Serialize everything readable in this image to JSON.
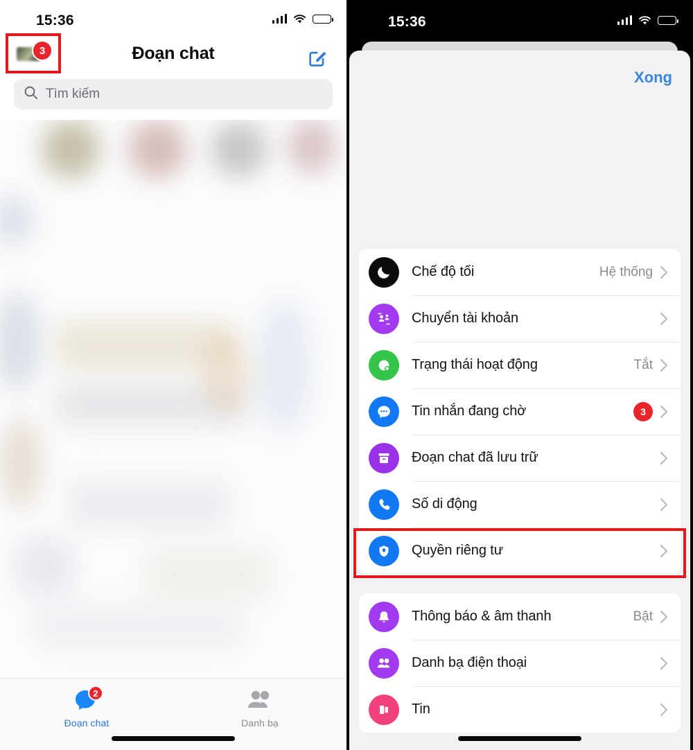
{
  "left": {
    "status_bar": {
      "time": "15:36",
      "signal_icon": "cellular-bars-icon",
      "wifi_icon": "wifi-icon",
      "battery_icon": "battery-icon"
    },
    "header": {
      "title": "Đoạn chat",
      "avatar_badge": "3",
      "compose_icon": "compose-icon",
      "avatar_name": "profile-avatar"
    },
    "search": {
      "placeholder": "Tìm kiếm",
      "icon": "search-icon"
    },
    "tabs": [
      {
        "label": "Đoạn chat",
        "icon": "chat-bubble-icon",
        "badge": "2",
        "active": true
      },
      {
        "label": "Danh bạ",
        "icon": "contacts-icon",
        "badge": "",
        "active": false
      }
    ]
  },
  "right": {
    "status_bar": {
      "time": "15:36",
      "signal_icon": "cellular-bars-icon",
      "wifi_icon": "wifi-icon",
      "battery_icon": "battery-icon"
    },
    "sheet": {
      "done_label": "Xong"
    },
    "groups": [
      {
        "rows": [
          {
            "label": "Chế độ tối",
            "value": "Hệ thống",
            "badge": "",
            "icon": "moon-icon",
            "color": "#0b0b0b"
          },
          {
            "label": "Chuyển tài khoản",
            "value": "",
            "badge": "",
            "icon": "switch-account-icon",
            "color": "#a23bef"
          },
          {
            "label": "Trạng thái hoạt động",
            "value": "Tắt",
            "badge": "",
            "icon": "active-status-icon",
            "color": "#35c44a"
          },
          {
            "label": "Tin nhắn đang chờ",
            "value": "",
            "badge": "3",
            "icon": "message-requests-icon",
            "color": "#1278f3"
          },
          {
            "label": "Đoạn chat đã lưu trữ",
            "value": "",
            "badge": "",
            "icon": "archive-icon",
            "color": "#9a33e8"
          },
          {
            "label": "Số di động",
            "value": "",
            "badge": "",
            "icon": "phone-icon",
            "color": "#1278f3"
          },
          {
            "label": "Quyền riêng tư",
            "value": "",
            "badge": "",
            "icon": "shield-icon",
            "color": "#1278f3",
            "highlighted": true
          }
        ]
      },
      {
        "rows": [
          {
            "label": "Thông báo & âm thanh",
            "value": "Bật",
            "badge": "",
            "icon": "bell-icon",
            "color": "#a23bef"
          },
          {
            "label": "Danh bạ điện thoại",
            "value": "",
            "badge": "",
            "icon": "contacts-icon",
            "color": "#a23bef"
          },
          {
            "label": "Tin",
            "value": "",
            "badge": "",
            "icon": "stories-icon",
            "color": "#f0417e"
          }
        ]
      }
    ]
  },
  "annotation": {
    "highlight_color": "#e01b1b"
  }
}
